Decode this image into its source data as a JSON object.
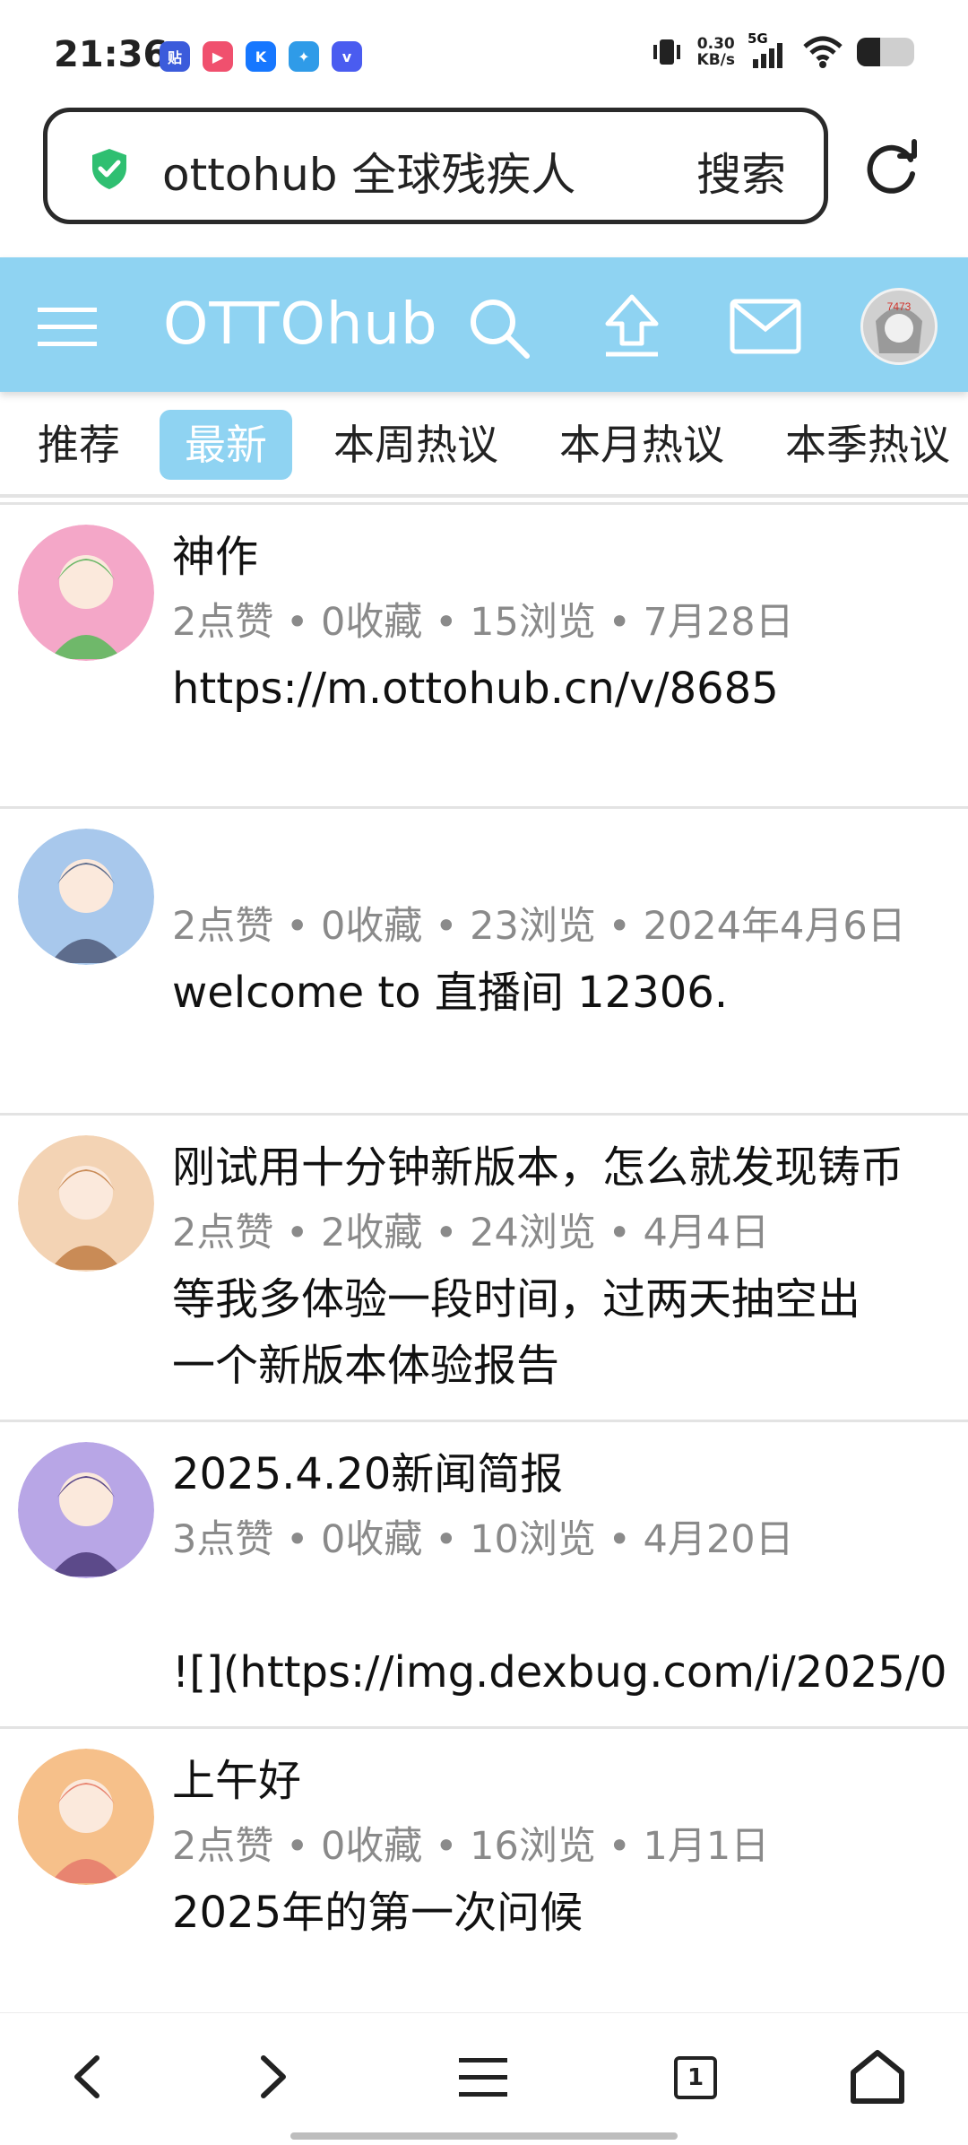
{
  "status_bar": {
    "time": "21:36",
    "app_icons": [
      {
        "name": "tieba-icon",
        "glyph": "贴",
        "color": "#3b5bdb"
      },
      {
        "name": "video-app-icon",
        "glyph": "▶",
        "color": "#f0506e"
      },
      {
        "name": "k-app-icon",
        "glyph": "K",
        "color": "#1677ff"
      },
      {
        "name": "telecom-icon",
        "glyph": "✦",
        "color": "#2f9be8"
      },
      {
        "name": "vivo-icon",
        "glyph": "v",
        "color": "#4a5cf0"
      }
    ],
    "net_speed_value": "0.30",
    "net_speed_unit": "KB/s",
    "network": "5G",
    "battery_level": 0.4
  },
  "browser": {
    "url_text": "ottohub 全球残疾人",
    "search_label": "搜索"
  },
  "header": {
    "title": "OTTOhub",
    "accent_color": "#8fd3f2"
  },
  "tabs": [
    {
      "label": "推荐",
      "active": false
    },
    {
      "label": "最新",
      "active": true
    },
    {
      "label": "本周热议",
      "active": false
    },
    {
      "label": "本月热议",
      "active": false
    },
    {
      "label": "本季热议",
      "active": false
    }
  ],
  "posts": [
    {
      "title": "神作",
      "meta": "2点赞 • 0收藏 • 15浏览 • 7月28日",
      "body": "https://m.ottohub.cn/v/8685",
      "avatar_colors": [
        "#f4a7c8",
        "#6fb86a"
      ]
    },
    {
      "title": "",
      "meta": "2点赞 • 0收藏 • 23浏览 • 2024年4月6日",
      "body": "welcome to 直播间 12306.",
      "avatar_colors": [
        "#a8c8ec",
        "#5d6c8c"
      ]
    },
    {
      "title": "刚试用十分钟新版本，怎么就发现铸币",
      "meta": "2点赞 • 2收藏 • 24浏览 • 4月4日",
      "body": "等我多体验一段时间，过两天抽空出\n一个新版本体验报告",
      "avatar_colors": [
        "#f3d3b4",
        "#c98b56"
      ]
    },
    {
      "title": "2025.4.20新闻简报",
      "meta": "3点赞 • 0收藏 • 10浏览 • 4月20日",
      "body": "\n![](https://img.dexbug.com/i/2025/0",
      "avatar_colors": [
        "#b8a6e6",
        "#5c4a8a"
      ]
    },
    {
      "title": "上午好",
      "meta": "2点赞 • 0收藏 • 16浏览 • 1月1日",
      "body": "2025年的第一次问候",
      "avatar_colors": [
        "#f6c08a",
        "#e88470"
      ]
    }
  ],
  "bottom_nav": {
    "tab_count": "1"
  }
}
